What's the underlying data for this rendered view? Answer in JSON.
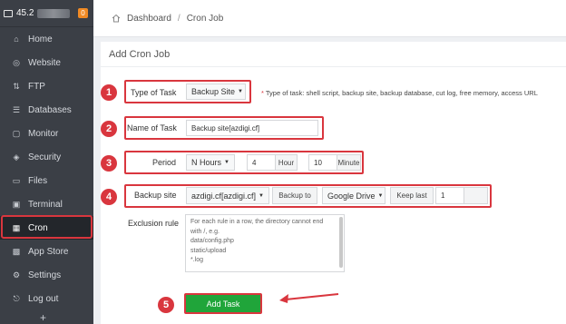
{
  "sidebar": {
    "host_label": "45.2",
    "badge": "0",
    "items": [
      {
        "label": "Home",
        "icon": "home-icon",
        "glyph": "⌂"
      },
      {
        "label": "Website",
        "icon": "globe-icon",
        "glyph": "◎"
      },
      {
        "label": "FTP",
        "icon": "ftp-icon",
        "glyph": "⇅"
      },
      {
        "label": "Databases",
        "icon": "database-icon",
        "glyph": "☰"
      },
      {
        "label": "Monitor",
        "icon": "monitor-icon",
        "glyph": "▢"
      },
      {
        "label": "Security",
        "icon": "shield-icon",
        "glyph": "◈"
      },
      {
        "label": "Files",
        "icon": "folder-icon",
        "glyph": "▭"
      },
      {
        "label": "Terminal",
        "icon": "terminal-icon",
        "glyph": "▣"
      },
      {
        "label": "Cron",
        "icon": "calendar-icon",
        "glyph": "▦"
      },
      {
        "label": "App Store",
        "icon": "apps-icon",
        "glyph": "▩"
      },
      {
        "label": "Settings",
        "icon": "gear-icon",
        "glyph": "⚙"
      },
      {
        "label": "Log out",
        "icon": "logout-icon",
        "glyph": "⎋"
      }
    ],
    "active": "Cron",
    "more": "+"
  },
  "breadcrumb": {
    "home": "Dashboard",
    "separator": "/",
    "current": "Cron Job"
  },
  "panel": {
    "title": "Add Cron Job"
  },
  "form": {
    "type_of_task": {
      "label": "Type of Task",
      "value": "Backup Site",
      "hint_star": "*",
      "hint": "Type of task: shell script, backup site, backup database, cut log, free memory, access URL"
    },
    "name_of_task": {
      "label": "Name of Task",
      "value": "Backup site[azdigi.cf]"
    },
    "period": {
      "label": "Period",
      "value": "N Hours",
      "hours_value": "4",
      "hours_unit": "Hour",
      "minutes_value": "10",
      "minutes_unit": "Minute"
    },
    "backup": {
      "label": "Backup site",
      "site": "azdigi.cf[azdigi.cf]",
      "backup_to_label": "Backup to",
      "backup_to": "Google Drive",
      "keep_last_label": "Keep last",
      "keep_last": "1"
    },
    "exclusion": {
      "label": "Exclusion rule",
      "placeholder_lines": [
        "For each rule in a row, the directory cannot end",
        "with /, e.g.",
        "data/config.php",
        "static/upload",
        "*.log"
      ]
    },
    "submit": "Add Task"
  },
  "steps": [
    "1",
    "2",
    "3",
    "4",
    "5"
  ],
  "colors": {
    "accent_red": "#d9363e",
    "button_green": "#20a53a",
    "sidebar_bg": "#3b3f46"
  }
}
